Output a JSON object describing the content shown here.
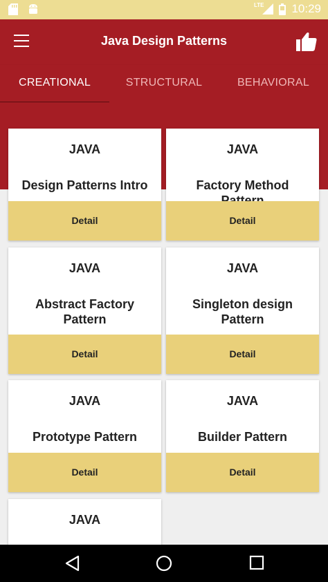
{
  "status_bar": {
    "time": "10:29",
    "network": "LTE",
    "icons": [
      "sd-card-icon",
      "android-icon",
      "signal-icon",
      "battery-icon"
    ]
  },
  "app_bar": {
    "title": "Java Design Patterns",
    "icons": [
      "menu-icon",
      "thumbs-up-icon"
    ]
  },
  "tabs": [
    {
      "label": "CREATIONAL",
      "active": true
    },
    {
      "label": "STRUCTURAL",
      "active": false
    },
    {
      "label": "BEHAVIORAL",
      "active": false
    }
  ],
  "cards": [
    {
      "lang": "JAVA",
      "title": "Design Patterns Intro",
      "button": "Detail"
    },
    {
      "lang": "JAVA",
      "title": "Factory Method Pattern",
      "button": "Detail"
    },
    {
      "lang": "JAVA",
      "title": "Abstract Factory Pattern",
      "button": "Detail"
    },
    {
      "lang": "JAVA",
      "title": "Singleton design Pattern",
      "button": "Detail"
    },
    {
      "lang": "JAVA",
      "title": "Prototype Pattern",
      "button": "Detail"
    },
    {
      "lang": "JAVA",
      "title": "Builder Pattern",
      "button": "Detail"
    },
    {
      "lang": "JAVA",
      "title": "",
      "button": ""
    }
  ],
  "colors": {
    "primary": "#a51d24",
    "accent": "#e9d07a",
    "status_bar": "#eddd93"
  },
  "nav_bar": {
    "icons": [
      "back-icon",
      "home-icon",
      "recents-icon"
    ]
  }
}
